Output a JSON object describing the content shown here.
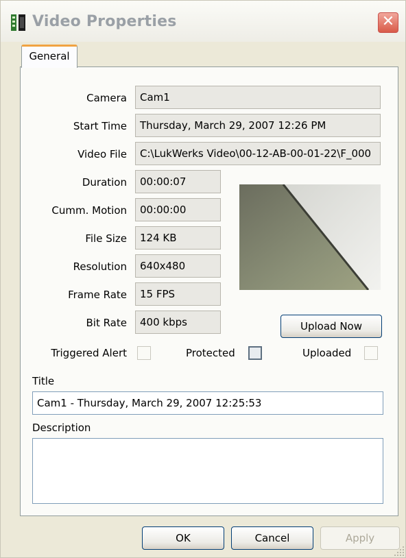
{
  "window": {
    "title": "Video Properties",
    "close_glyph": "✕",
    "icon": "video-properties-icon"
  },
  "tabs": [
    {
      "label": "General",
      "selected": true
    }
  ],
  "fields": {
    "camera": {
      "label": "Camera",
      "value": "Cam1"
    },
    "start_time": {
      "label": "Start Time",
      "value": "Thursday, March 29, 2007 12:26 PM"
    },
    "video_file": {
      "label": "Video File",
      "value": "C:\\LukWerks Video\\00-12-AB-00-01-22\\F_000"
    },
    "duration": {
      "label": "Duration",
      "value": "00:00:07"
    },
    "cumm_motion": {
      "label": "Cumm. Motion",
      "value": "00:00:00"
    },
    "file_size": {
      "label": "File Size",
      "value": "124 KB"
    },
    "resolution": {
      "label": "Resolution",
      "value": "640x480"
    },
    "frame_rate": {
      "label": "Frame Rate",
      "value": "15 FPS"
    },
    "bit_rate": {
      "label": "Bit Rate",
      "value": "400 kbps"
    }
  },
  "checkboxes": {
    "triggered_alert": {
      "label": "Triggered Alert",
      "checked": false
    },
    "protected": {
      "label": "Protected",
      "checked": false
    },
    "uploaded": {
      "label": "Uploaded",
      "checked": false
    }
  },
  "upload_button": "Upload Now",
  "title_section": {
    "label": "Title",
    "value": "Cam1 - Thursday, March 29, 2007 12:25:53"
  },
  "description_section": {
    "label": "Description",
    "value": ""
  },
  "buttons": {
    "ok": "OK",
    "cancel": "Cancel",
    "apply": "Apply"
  },
  "colors": {
    "tab_accent": "#f1a341",
    "button_border": "#003c74",
    "close_red": "#d95a48"
  }
}
